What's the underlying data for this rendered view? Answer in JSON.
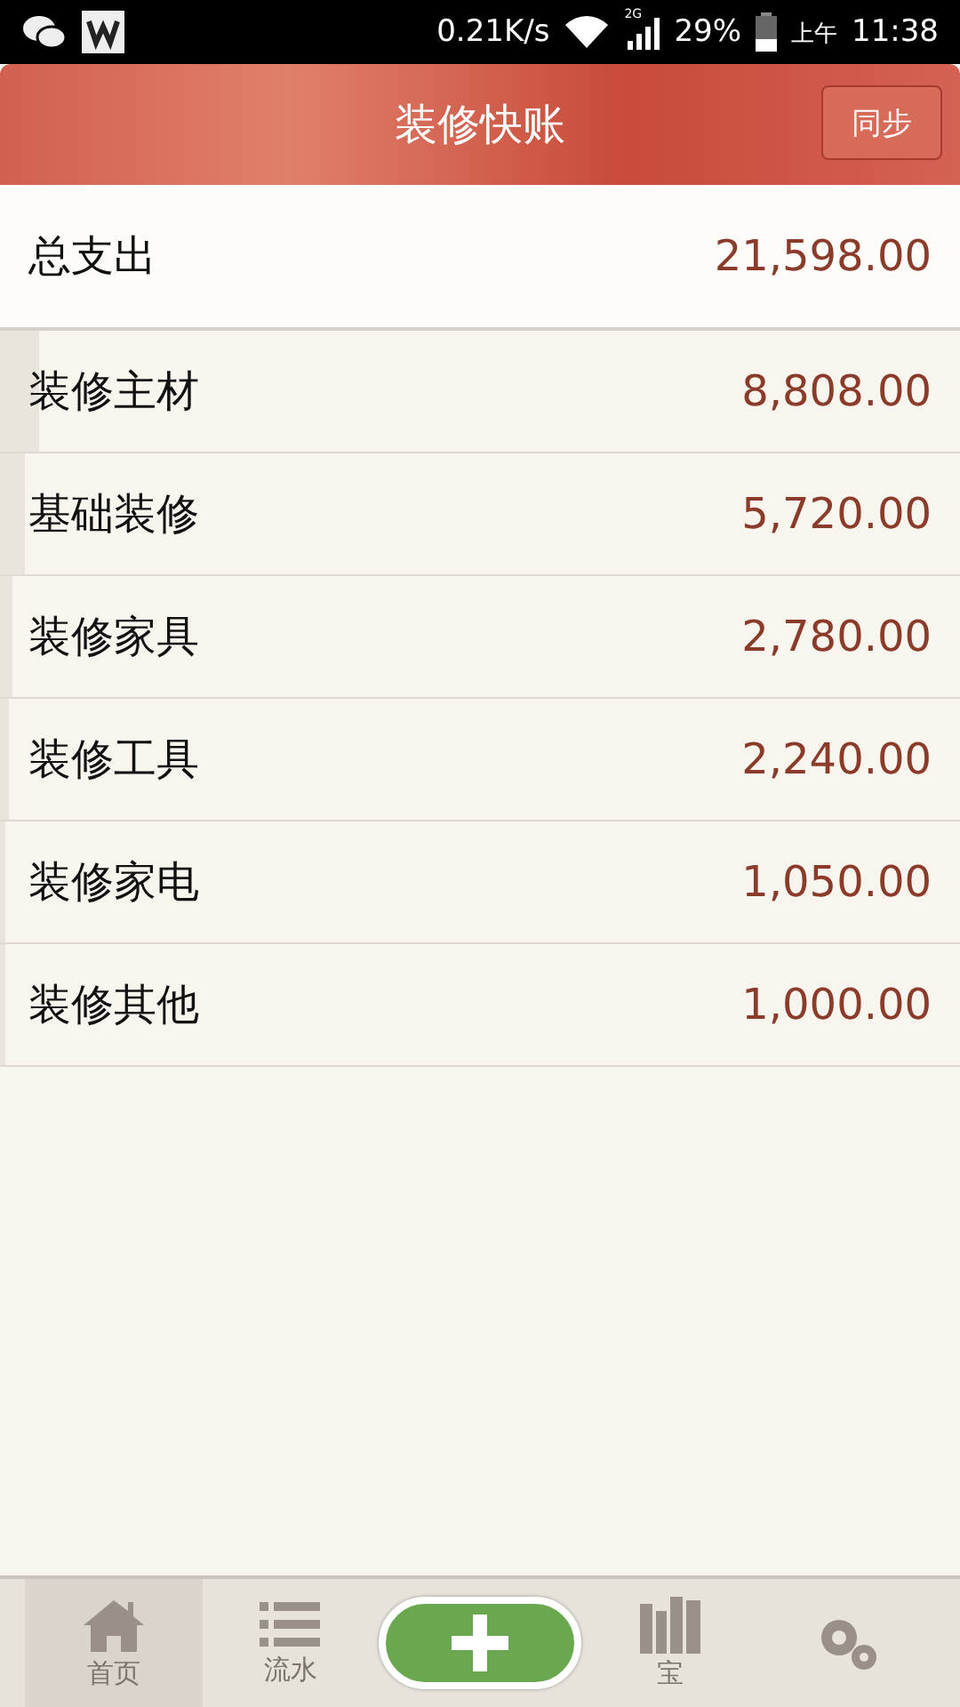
{
  "status_bar": {
    "net_speed": "0.21K/s",
    "network": "2G",
    "battery": "29%",
    "time_prefix": "上午",
    "time": "11:38"
  },
  "header": {
    "title": "装修快账",
    "sync_button": "同步"
  },
  "total": {
    "label": "总支出",
    "amount": "21,598.00"
  },
  "categories": [
    {
      "name": "装修主材",
      "amount": "8,808.00",
      "level": 0.041
    },
    {
      "name": "基础装修",
      "amount": "5,720.00",
      "level": 0.026
    },
    {
      "name": "装修家具",
      "amount": "2,780.00",
      "level": 0.013
    },
    {
      "name": "装修工具",
      "amount": "2,240.00",
      "level": 0.01
    },
    {
      "name": "装修家电",
      "amount": "1,050.00",
      "level": 0.005
    },
    {
      "name": "装修其他",
      "amount": "1,000.00",
      "level": 0.005
    }
  ],
  "tabs": [
    {
      "kind": "home",
      "label": "首页",
      "selected": true
    },
    {
      "kind": "list",
      "label": "流水",
      "selected": false
    },
    {
      "kind": "add",
      "selected": false
    },
    {
      "kind": "books",
      "label": "宝",
      "selected": false
    },
    {
      "kind": "settings",
      "selected": false
    }
  ]
}
